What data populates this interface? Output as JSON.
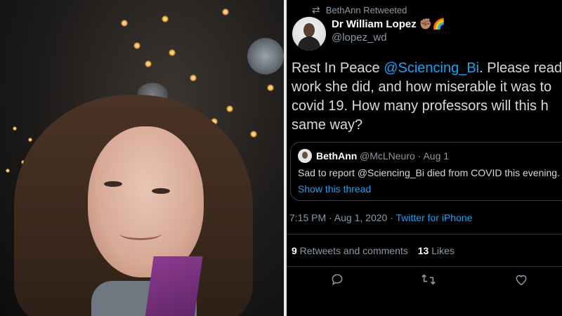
{
  "retweet_header": {
    "text": "BethAnn Retweeted",
    "icon": "retweet-icon"
  },
  "author": {
    "name": "Dr William Lopez",
    "emoji": "✊🏽🌈",
    "handle": "@lopez_wd"
  },
  "tweet": {
    "prefix": "Rest In Peace ",
    "mention": "@Sciencing_Bi",
    "line1_rest": ". Please read",
    "line2": "work she did, and how miserable it was to",
    "line3": "covid 19. How many professors will this h",
    "line4": "same way?"
  },
  "quoted": {
    "name": "BethAnn",
    "handle_date": "@McLNeuro · Aug 1",
    "text": "Sad to report @Sciencing_Bi died from COVID this evening.",
    "show_thread": "Show this thread"
  },
  "meta": {
    "time_date": "7:15 PM · Aug 1, 2020 · ",
    "source": "Twitter for iPhone"
  },
  "stats": {
    "retweets_count": "9",
    "retweets_label": " Retweets and comments",
    "likes_count": "13",
    "likes_label": " Likes"
  },
  "actions": {
    "reply": "reply-icon",
    "retweet": "retweet-icon",
    "like": "heart-icon"
  },
  "colors": {
    "link": "#1da1f2",
    "muted": "#8b98a5",
    "background": "#000000",
    "divider": "#e7e7e7"
  }
}
